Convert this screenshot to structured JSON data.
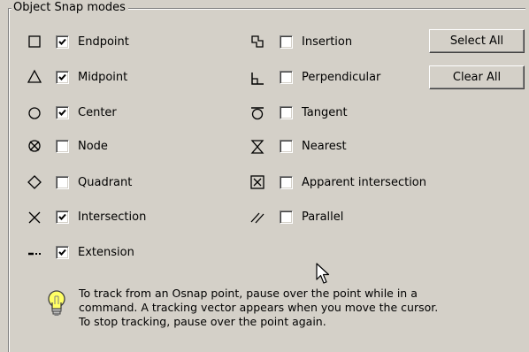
{
  "group": {
    "title": "Object Snap modes"
  },
  "left_column": [
    {
      "label": "Endpoint",
      "checked": true,
      "icon": "endpoint-icon"
    },
    {
      "label": "Midpoint",
      "checked": true,
      "icon": "midpoint-icon"
    },
    {
      "label": "Center",
      "checked": true,
      "icon": "center-icon"
    },
    {
      "label": "Node",
      "checked": false,
      "icon": "node-icon"
    },
    {
      "label": "Quadrant",
      "checked": false,
      "icon": "quadrant-icon"
    },
    {
      "label": "Intersection",
      "checked": true,
      "icon": "intersection-icon"
    },
    {
      "label": "Extension",
      "checked": true,
      "icon": "extension-icon"
    }
  ],
  "right_column": [
    {
      "label": "Insertion",
      "checked": false,
      "icon": "insertion-icon"
    },
    {
      "label": "Perpendicular",
      "checked": false,
      "icon": "perpendicular-icon"
    },
    {
      "label": "Tangent",
      "checked": false,
      "icon": "tangent-icon"
    },
    {
      "label": "Nearest",
      "checked": false,
      "icon": "nearest-icon"
    },
    {
      "label": "Apparent intersection",
      "checked": false,
      "icon": "apparent-intersection-icon"
    },
    {
      "label": "Parallel",
      "checked": false,
      "icon": "parallel-icon"
    }
  ],
  "buttons": {
    "select_all": "Select All",
    "clear_all": "Clear All"
  },
  "tip": {
    "line1": "To track from an Osnap point, pause over the point while in a",
    "line2": "command.  A tracking vector appears when you move the cursor.",
    "line3": "To stop tracking, pause over the point again."
  }
}
